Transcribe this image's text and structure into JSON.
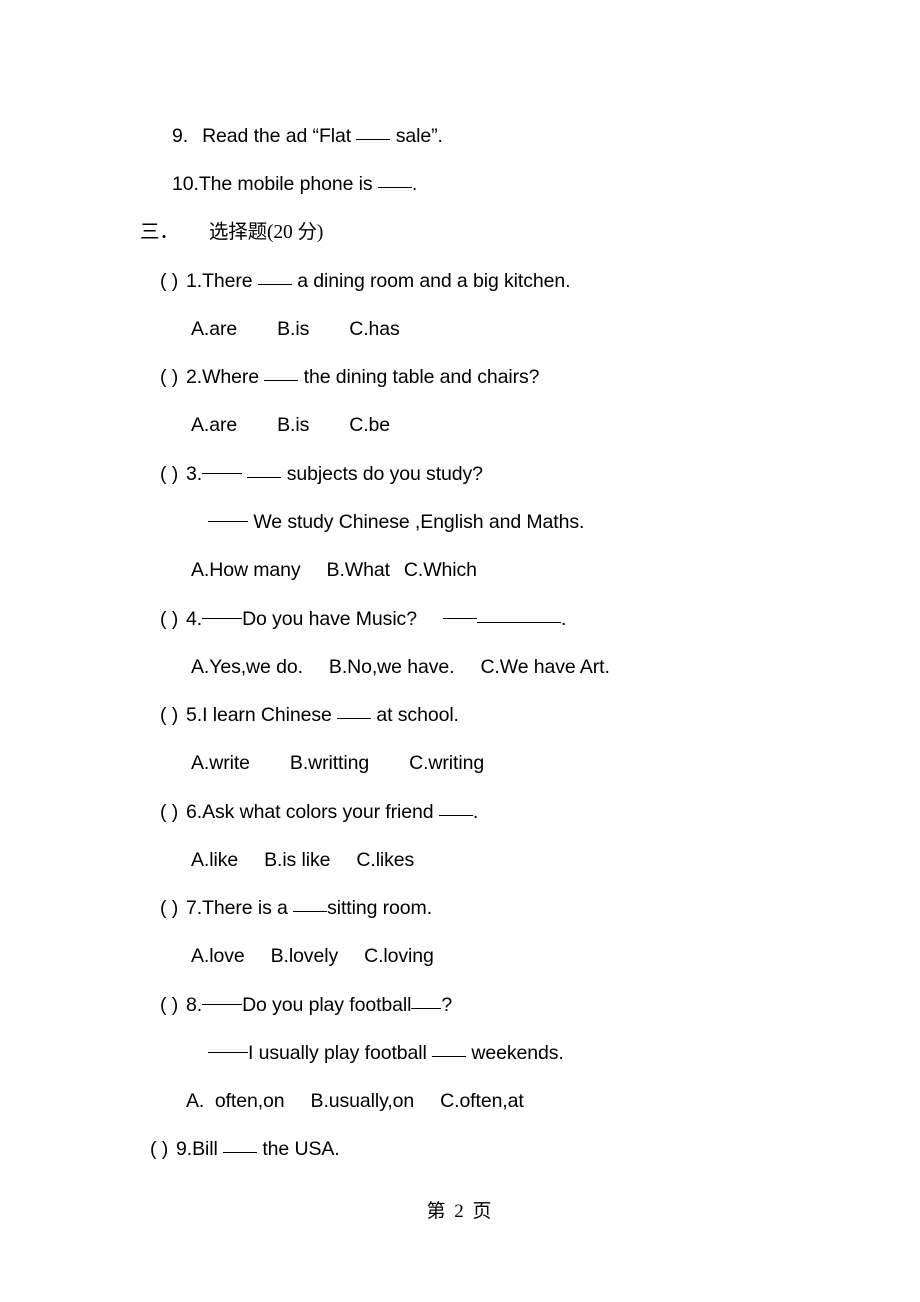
{
  "document": {
    "fill_in_questions": [
      {
        "number": "9.",
        "text_before": "Read the ad “Flat",
        "text_after": "sale”."
      },
      {
        "number": "10.",
        "text_before": "The mobile phone is",
        "text_after": "."
      }
    ],
    "section": {
      "number": "三．",
      "label": "选择题(20 分)"
    },
    "choice_questions": [
      {
        "paren": "(    )",
        "number": "1.",
        "stem_before": "There",
        "stem_after": "a dining room and a big kitchen.",
        "options": [
          "A.are",
          "B.is",
          "C.has"
        ]
      },
      {
        "paren": "(    )",
        "number": "2.",
        "stem_before": "Where",
        "stem_after": "the dining table and chairs?",
        "options": [
          "A.are",
          "B.is",
          "C.be"
        ]
      },
      {
        "paren": "(    )",
        "number": "3.",
        "stem_after": "subjects do you study?",
        "continuation": "We study Chinese ,English and Maths.",
        "options": [
          "A.How many",
          "B.What",
          "C.Which"
        ]
      },
      {
        "paren": "(    )",
        "number": "4.",
        "stem_before": "Do you have Music?",
        "options": [
          "A.Yes,we do.",
          "B.No,we have.",
          "C.We have Art."
        ]
      },
      {
        "paren": "(    )",
        "number": "5.",
        "stem_before": "I learn Chinese",
        "stem_after": "at school.",
        "options": [
          "A.write",
          "B.writting",
          "C.writing"
        ]
      },
      {
        "paren": "(    )",
        "number": "6.",
        "stem_before": "Ask what colors your friend",
        "stem_after": ".",
        "options": [
          "A.like",
          "B.is like",
          "C.likes"
        ]
      },
      {
        "paren": "(    )",
        "number": "7.",
        "stem_before": "There is a",
        "stem_after": "sitting room.",
        "options": [
          "A.love",
          "B.lovely",
          "C.loving"
        ]
      },
      {
        "paren": "(    )",
        "number": "8.",
        "stem_before": "Do you play football",
        "stem_after": "?",
        "continuation_before": "I usually play football",
        "continuation_after": "weekends.",
        "options": [
          "A.  often,on",
          "B.usually,on",
          "C.often,at"
        ]
      },
      {
        "paren": "(    )",
        "number": "9.",
        "stem_before": "Bill",
        "stem_after": "the USA."
      }
    ],
    "footer": "第  2  页"
  }
}
